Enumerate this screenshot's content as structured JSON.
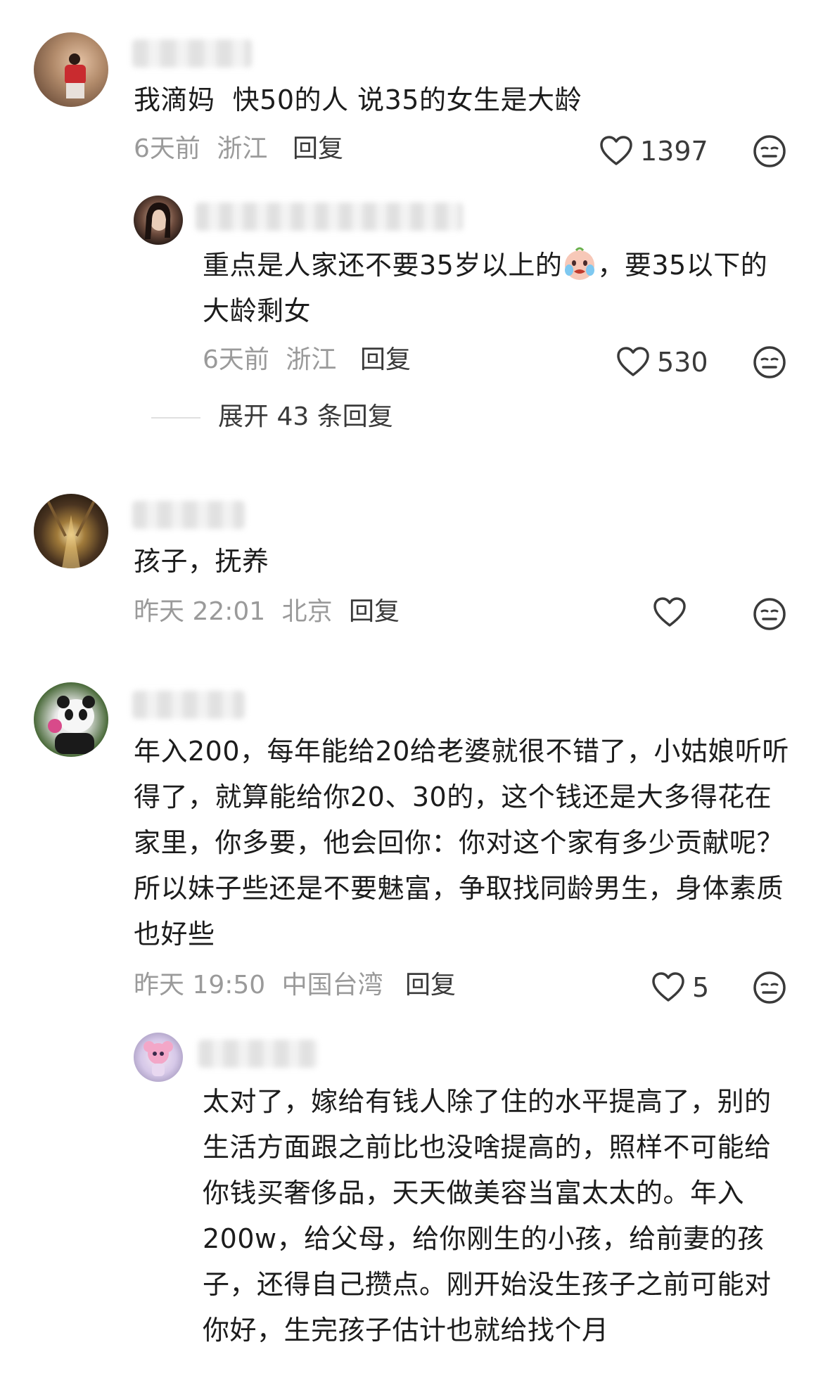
{
  "comments": [
    {
      "text": "我滴妈  快50的人 说35的女生是大龄",
      "time": "6天前",
      "location": "浙江",
      "reply_label": "回复",
      "likes": "1397"
    },
    {
      "text_before_emoji": "重点是人家还不要35岁以上的",
      "emoji": "crying-face-emoji",
      "text_after_emoji": "，要35以下的大龄剩女",
      "time": "6天前",
      "location": "浙江",
      "reply_label": "回复",
      "likes": "530"
    },
    {
      "text": "孩子，抚养",
      "time": "昨天 22:01",
      "location": "北京",
      "reply_label": "回复",
      "likes": ""
    },
    {
      "text": "年入200，每年能给20给老婆就很不错了，小姑娘听听得了，就算能给你20、30的，这个钱还是大多得花在家里，你多要，他会回你：你对这个家有多少贡献呢？   所以妹子些还是不要魅富，争取找同龄男生，身体素质也好些",
      "time": "昨天 19:50",
      "location": "中国台湾",
      "reply_label": "回复",
      "likes": "5"
    },
    {
      "text": "太对了，嫁给有钱人除了住的水平提高了，别的生活方面跟之前比也没啥提高的，照样不可能给你钱买奢侈品，天天做美容当富太太的。年入200w，给父母，给你刚生的小孩，给前妻的孩子，还得自己攒点。刚开始没生孩子之前可能对你好，生完孩子估计也就给找个月"
    }
  ],
  "expand_replies": "展开 43 条回复",
  "icons": {
    "like": "heart-outline-icon",
    "dislike": "neutral-face-icon"
  },
  "colors": {
    "meta_text": "#9a9a9a",
    "body_text": "#1c1c1c",
    "action_text": "#3a3a3a"
  }
}
